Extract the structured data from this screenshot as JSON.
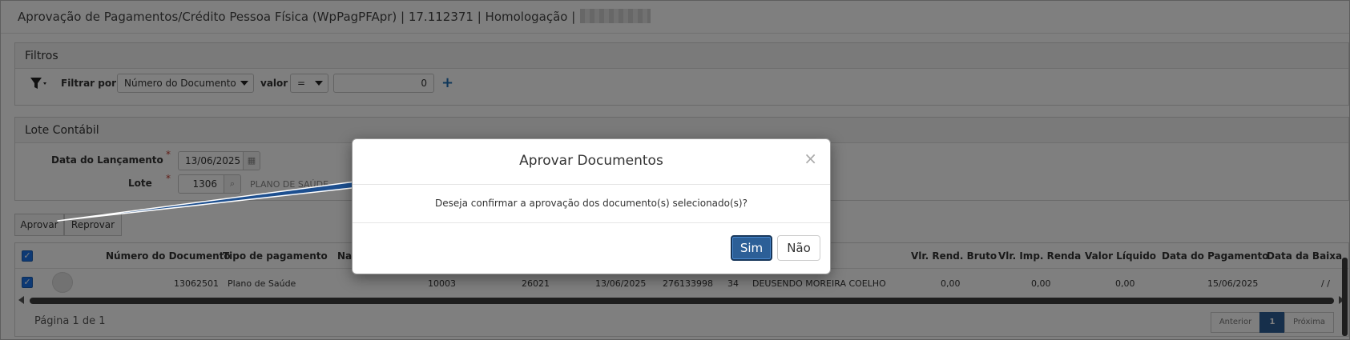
{
  "app": {
    "title": "Aprovação de Pagamentos/Crédito Pessoa Física (WpPagPFApr) | 17.112371 | Homologação |"
  },
  "filtros": {
    "header": "Filtros",
    "filtrar_por_label": "Filtrar por",
    "campo_selected": "Número do Documento",
    "valor_label": "valor",
    "operador_selected": "=",
    "valor_value": "0",
    "add_icon": "plus-icon"
  },
  "lote": {
    "header": "Lote Contábil",
    "data_label": "Data do Lançamento",
    "data_value": "13/06/2025",
    "required_mark": "*",
    "lote_label": "Lote",
    "lote_value": "1306",
    "lote_desc": "PLANO DE SAÚDE"
  },
  "actions": {
    "aprovar": "Aprovar",
    "reprovar": "Reprovar"
  },
  "grid": {
    "headers": {
      "numero": "Número do Documento",
      "tipo": "Tipo de pagamento",
      "nat": "Nat",
      "bruto": "Vlr. Rend. Bruto",
      "imp": "Vlr. Imp. Renda",
      "liquido": "Valor Líquido",
      "data_pag": "Data do Pagamento",
      "data_baixa": "Data da Baixa"
    },
    "row": {
      "numero": "13062501",
      "tipo": "Plano de Saúde",
      "c3": "10003",
      "c4": "26021",
      "c5": "13/06/2025",
      "c6": "276133998",
      "c7": "34",
      "nome": "DEUSENDO MOREIRA COELHO",
      "bruto": "0,00",
      "imp": "0,00",
      "liquido": "0,00",
      "data_pag": "15/06/2025",
      "data_baixa": "/ /"
    },
    "page_info": "Página 1 de 1",
    "pager": {
      "prev": "Anterior",
      "current": "1",
      "next": "Próxima"
    }
  },
  "modal": {
    "title": "Aprovar Documentos",
    "close": "×",
    "message": "Deseja confirmar a aprovação dos documento(s) selecionado(s)?",
    "yes": "Sim",
    "no": "Não"
  },
  "colors": {
    "primary": "#2c5f97",
    "checkbox": "#1a73e8",
    "arrow": "#1d4f8f",
    "required": "#c0392b"
  }
}
